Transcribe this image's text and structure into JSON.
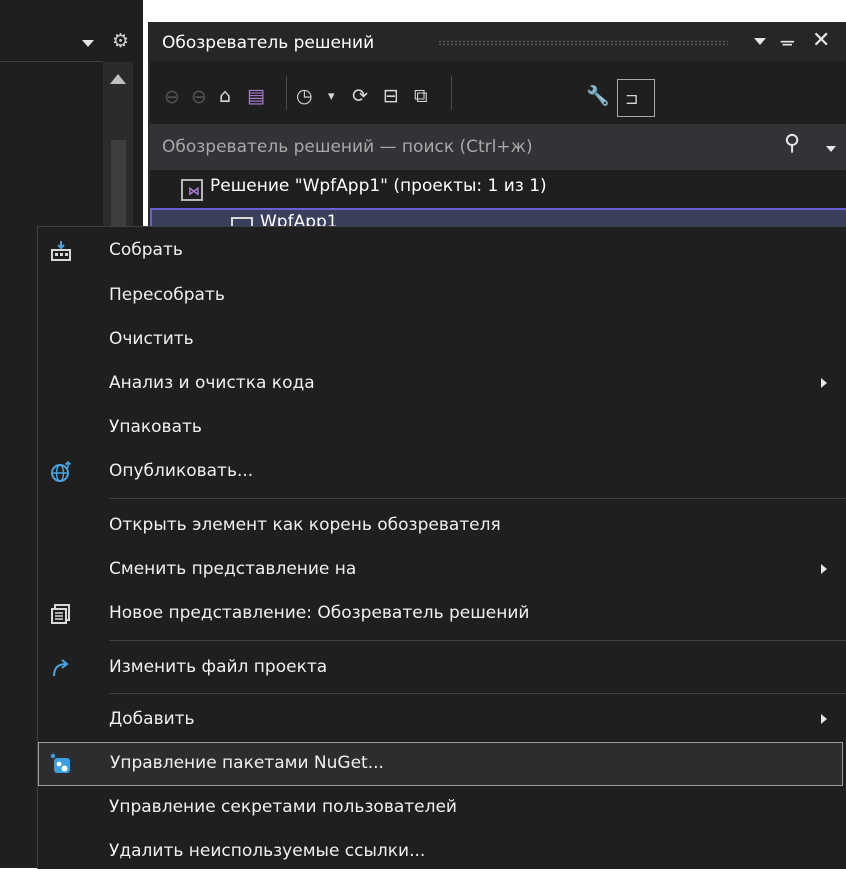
{
  "solution_explorer": {
    "title": "Обозреватель решений",
    "search_placeholder": "Обозреватель решений — поиск (Ctrl+ж)",
    "solution_label": "Решение \"WpfApp1\" (проекты: 1 из 1)",
    "project_label": "WpfApp1"
  },
  "icons": {
    "gear": "gear-icon",
    "pin": "pin-icon",
    "close": "close-icon",
    "back": "back-icon",
    "forward": "forward-icon",
    "home": "home-icon",
    "switch_views": "switch-views-icon",
    "pending_changes": "pending-changes-icon",
    "refresh": "refresh-icon",
    "collapse_all": "collapse-all-icon",
    "show_all_files": "show-all-files-icon",
    "properties": "wrench-icon",
    "preview": "preview-selected-items-icon",
    "search": "search-icon",
    "build": "build-icon",
    "publish": "globe-publish-icon",
    "new_view": "new-view-icon",
    "edit_project": "redo-arrow-icon",
    "nuget": "nuget-icon"
  },
  "colors": {
    "background": "#1f1f1f",
    "selection_border": "#6e5fd6",
    "nuget_blue": "#3aa0e0",
    "publish_blue": "#4aa3df"
  },
  "context_menu": {
    "items": [
      {
        "label": "Собрать",
        "icon": "build-icon",
        "submenu": false
      },
      {
        "label": "Пересобрать",
        "submenu": false
      },
      {
        "label": "Очистить",
        "submenu": false
      },
      {
        "label": "Анализ и очистка кода",
        "submenu": true
      },
      {
        "label": "Упаковать",
        "submenu": false
      },
      {
        "label": "Опубликовать...",
        "icon": "globe-publish-icon",
        "submenu": false
      },
      {
        "label": "Открыть элемент как корень обозревателя",
        "submenu": false
      },
      {
        "label": "Сменить представление на",
        "submenu": true
      },
      {
        "label": "Новое представление: Обозреватель решений",
        "icon": "new-view-icon",
        "submenu": false
      },
      {
        "label": "Изменить файл проекта",
        "icon": "redo-arrow-icon",
        "submenu": false
      },
      {
        "label": "Добавить",
        "submenu": true
      },
      {
        "label": "Управление пакетами NuGet...",
        "icon": "nuget-icon",
        "submenu": false,
        "highlighted": true
      },
      {
        "label": "Управление секретами пользователей",
        "submenu": false
      },
      {
        "label": "Удалить неиспользуемые ссылки...",
        "submenu": false
      }
    ]
  }
}
